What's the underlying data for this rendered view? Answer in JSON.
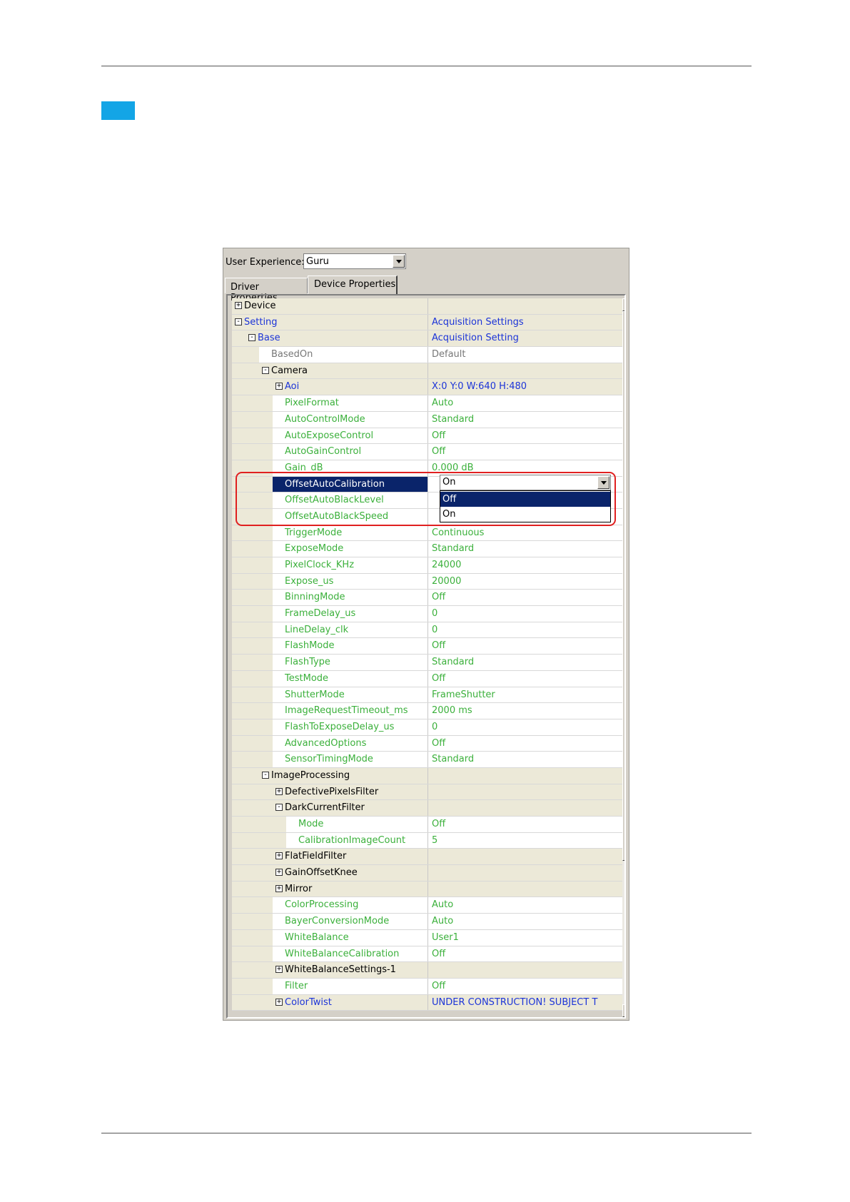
{
  "ux": {
    "label": "User Experience:",
    "value": "Guru"
  },
  "tabs": [
    "Driver Properties",
    "Device Properties"
  ],
  "rows": [
    {
      "name": "Device",
      "value": "",
      "level": 0,
      "expander": "+",
      "color": "def",
      "node": true
    },
    {
      "name": "Setting",
      "value": "Acquisition Settings",
      "level": 0,
      "expander": "-",
      "color": "blue",
      "valcolor": "blue",
      "node": true
    },
    {
      "name": "Base",
      "value": "Acquisition Setting",
      "level": 1,
      "expander": "-",
      "color": "blue",
      "valcolor": "blue",
      "node": true
    },
    {
      "name": "BasedOn",
      "value": "Default",
      "level": 2,
      "color": "gray",
      "valcolor": "gray"
    },
    {
      "name": "Camera",
      "value": "",
      "level": 2,
      "expander": "-",
      "color": "def",
      "node": true
    },
    {
      "name": "Aoi",
      "value": "X:0 Y:0 W:640 H:480",
      "level": 3,
      "expander": "+",
      "color": "blue",
      "valcolor": "blue",
      "node": true
    },
    {
      "name": "PixelFormat",
      "value": "Auto",
      "level": 3,
      "color": "green",
      "valcolor": "green"
    },
    {
      "name": "AutoControlMode",
      "value": "Standard",
      "level": 3,
      "color": "green",
      "valcolor": "green"
    },
    {
      "name": "AutoExposeControl",
      "value": "Off",
      "level": 3,
      "color": "green",
      "valcolor": "green"
    },
    {
      "name": "AutoGainControl",
      "value": "Off",
      "level": 3,
      "color": "green",
      "valcolor": "green"
    },
    {
      "name": "Gain_dB",
      "value": "0.000 dB",
      "level": 3,
      "color": "green",
      "valcolor": "green"
    },
    {
      "name": "OffsetAutoCalibration",
      "value": "",
      "level": 3,
      "color": "white",
      "selected": true
    },
    {
      "name": "OffsetAutoBlackLevel",
      "value": "",
      "level": 3,
      "color": "green",
      "valcolor": "green"
    },
    {
      "name": "OffsetAutoBlackSpeed",
      "value": "",
      "level": 3,
      "color": "green",
      "valcolor": "green"
    },
    {
      "name": "TriggerMode",
      "value": "Continuous",
      "level": 3,
      "color": "green",
      "valcolor": "green"
    },
    {
      "name": "ExposeMode",
      "value": "Standard",
      "level": 3,
      "color": "green",
      "valcolor": "green"
    },
    {
      "name": "PixelClock_KHz",
      "value": "24000",
      "level": 3,
      "color": "green",
      "valcolor": "green"
    },
    {
      "name": "Expose_us",
      "value": "20000",
      "level": 3,
      "color": "green",
      "valcolor": "green"
    },
    {
      "name": "BinningMode",
      "value": "Off",
      "level": 3,
      "color": "green",
      "valcolor": "green"
    },
    {
      "name": "FrameDelay_us",
      "value": "0",
      "level": 3,
      "color": "green",
      "valcolor": "green"
    },
    {
      "name": "LineDelay_clk",
      "value": "0",
      "level": 3,
      "color": "green",
      "valcolor": "green"
    },
    {
      "name": "FlashMode",
      "value": "Off",
      "level": 3,
      "color": "green",
      "valcolor": "green"
    },
    {
      "name": "FlashType",
      "value": "Standard",
      "level": 3,
      "color": "green",
      "valcolor": "green"
    },
    {
      "name": "TestMode",
      "value": "Off",
      "level": 3,
      "color": "green",
      "valcolor": "green"
    },
    {
      "name": "ShutterMode",
      "value": "FrameShutter",
      "level": 3,
      "color": "green",
      "valcolor": "green"
    },
    {
      "name": "ImageRequestTimeout_ms",
      "value": "2000 ms",
      "level": 3,
      "color": "green",
      "valcolor": "green"
    },
    {
      "name": "FlashToExposeDelay_us",
      "value": "0",
      "level": 3,
      "color": "green",
      "valcolor": "green"
    },
    {
      "name": "AdvancedOptions",
      "value": "Off",
      "level": 3,
      "color": "green",
      "valcolor": "green"
    },
    {
      "name": "SensorTimingMode",
      "value": "Standard",
      "level": 3,
      "color": "green",
      "valcolor": "green"
    },
    {
      "name": "ImageProcessing",
      "value": "",
      "level": 2,
      "expander": "-",
      "color": "def",
      "node": true
    },
    {
      "name": "DefectivePixelsFilter",
      "value": "",
      "level": 3,
      "expander": "+",
      "color": "def",
      "node": true
    },
    {
      "name": "DarkCurrentFilter",
      "value": "",
      "level": 3,
      "expander": "-",
      "color": "def",
      "node": true
    },
    {
      "name": "Mode",
      "value": "Off",
      "level": 4,
      "color": "green",
      "valcolor": "green"
    },
    {
      "name": "CalibrationImageCount",
      "value": "5",
      "level": 4,
      "color": "green",
      "valcolor": "green"
    },
    {
      "name": "FlatFieldFilter",
      "value": "",
      "level": 3,
      "expander": "+",
      "color": "def",
      "node": true
    },
    {
      "name": "GainOffsetKnee",
      "value": "",
      "level": 3,
      "expander": "+",
      "color": "def",
      "node": true
    },
    {
      "name": "Mirror",
      "value": "",
      "level": 3,
      "expander": "+",
      "color": "def",
      "node": true
    },
    {
      "name": "ColorProcessing",
      "value": "Auto",
      "level": 3,
      "color": "green",
      "valcolor": "green"
    },
    {
      "name": "BayerConversionMode",
      "value": "Auto",
      "level": 3,
      "color": "green",
      "valcolor": "green"
    },
    {
      "name": "WhiteBalance",
      "value": "User1",
      "level": 3,
      "color": "green",
      "valcolor": "green"
    },
    {
      "name": "WhiteBalanceCalibration",
      "value": "Off",
      "level": 3,
      "color": "green",
      "valcolor": "green"
    },
    {
      "name": "WhiteBalanceSettings-1",
      "value": "",
      "level": 3,
      "expander": "+",
      "color": "def",
      "node": true
    },
    {
      "name": "Filter",
      "value": "Off",
      "level": 3,
      "color": "green",
      "valcolor": "green"
    },
    {
      "name": "ColorTwist",
      "value": "UNDER CONSTRUCTION! SUBJECT TO",
      "level": 3,
      "expander": "+",
      "color": "blue",
      "valcolor": "blue",
      "node": true
    }
  ],
  "dropdown": {
    "current": "On",
    "options": [
      "Off",
      "On"
    ],
    "highlighted": "Off"
  },
  "colors": {
    "accent": "#13a5e6",
    "highlight_box": "#e02020",
    "selection": "#0a246a"
  }
}
